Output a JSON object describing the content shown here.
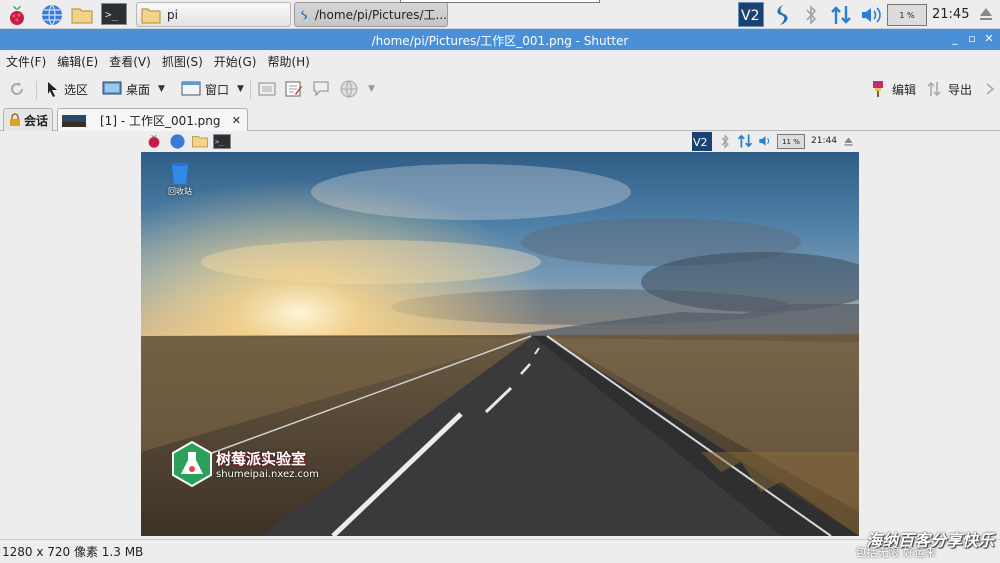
{
  "panel": {
    "tasks": [
      {
        "label": "pi"
      },
      {
        "label": "/home/pi/Pictures/工..."
      }
    ],
    "battery": "1 %",
    "clock": "21:45"
  },
  "window": {
    "title": "/home/pi/Pictures/工作区_001.png - Shutter"
  },
  "menu": [
    "文件(F)",
    "编辑(E)",
    "查看(V)",
    "抓图(S)",
    "开始(G)",
    "帮助(H)"
  ],
  "toolbar": {
    "selection": "选区",
    "desktop": "桌面",
    "window": "窗口",
    "edit": "编辑",
    "export": "导出"
  },
  "tabs": {
    "session": "会话",
    "image": "[1] - 工作区_001.png"
  },
  "screenshot": {
    "battery": "11 %",
    "clock": "21:44",
    "trash_label": "回收站",
    "logo_title": "树莓派实验室",
    "logo_url": "shumeipai.nxez.com"
  },
  "status": {
    "info": "1280 x 720 像素  1.3 MB"
  },
  "watermark": {
    "main": "海纳百客分享快乐",
    "sub": "包括无限  好运来"
  }
}
